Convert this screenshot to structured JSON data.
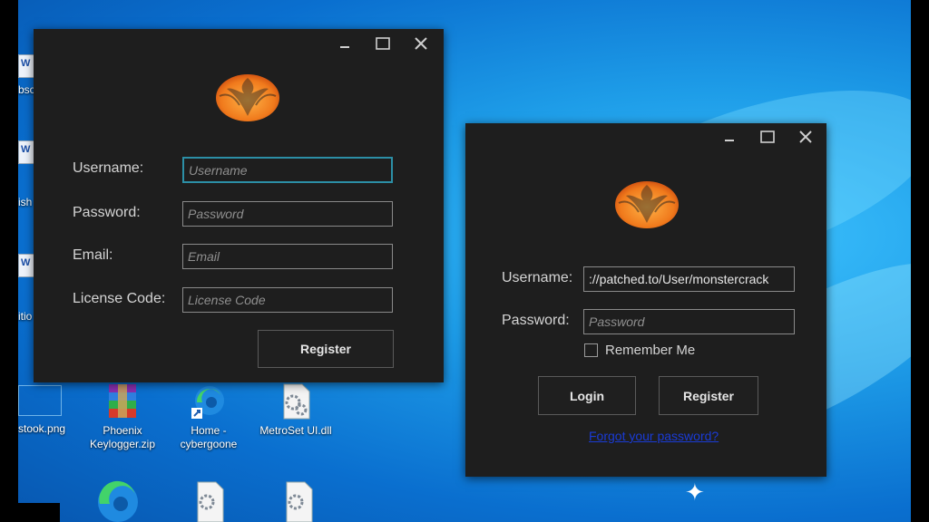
{
  "desktop": {
    "icons": [
      {
        "id": "winrar",
        "label": "Phoenix Keylogger.zip"
      },
      {
        "id": "edge",
        "label": "Home - cybergoone"
      },
      {
        "id": "dll",
        "label": "MetroSet UI.dll"
      }
    ],
    "partial_labels": {
      "stook": "stook.png",
      "bsc": "bsc",
      "ish": "ish",
      "itio": "itio"
    }
  },
  "register_window": {
    "username_label": "Username:",
    "username_placeholder": "Username",
    "password_label": "Password:",
    "password_placeholder": "Password",
    "email_label": "Email:",
    "email_placeholder": "Email",
    "license_label": "License Code:",
    "license_placeholder": "License Code",
    "register_button": "Register"
  },
  "login_window": {
    "username_label": "Username:",
    "username_value": "://patched.to/User/monstercrack",
    "password_label": "Password:",
    "password_placeholder": "Password",
    "remember_label": "Remember Me",
    "login_button": "Login",
    "register_button": "Register",
    "forgot_link": "Forgot your password?"
  },
  "colors": {
    "window_bg": "#1e1e1e",
    "focus_border": "#2c8fa6",
    "logo_orange": "#f07a1c",
    "link": "#1a3bd6"
  }
}
